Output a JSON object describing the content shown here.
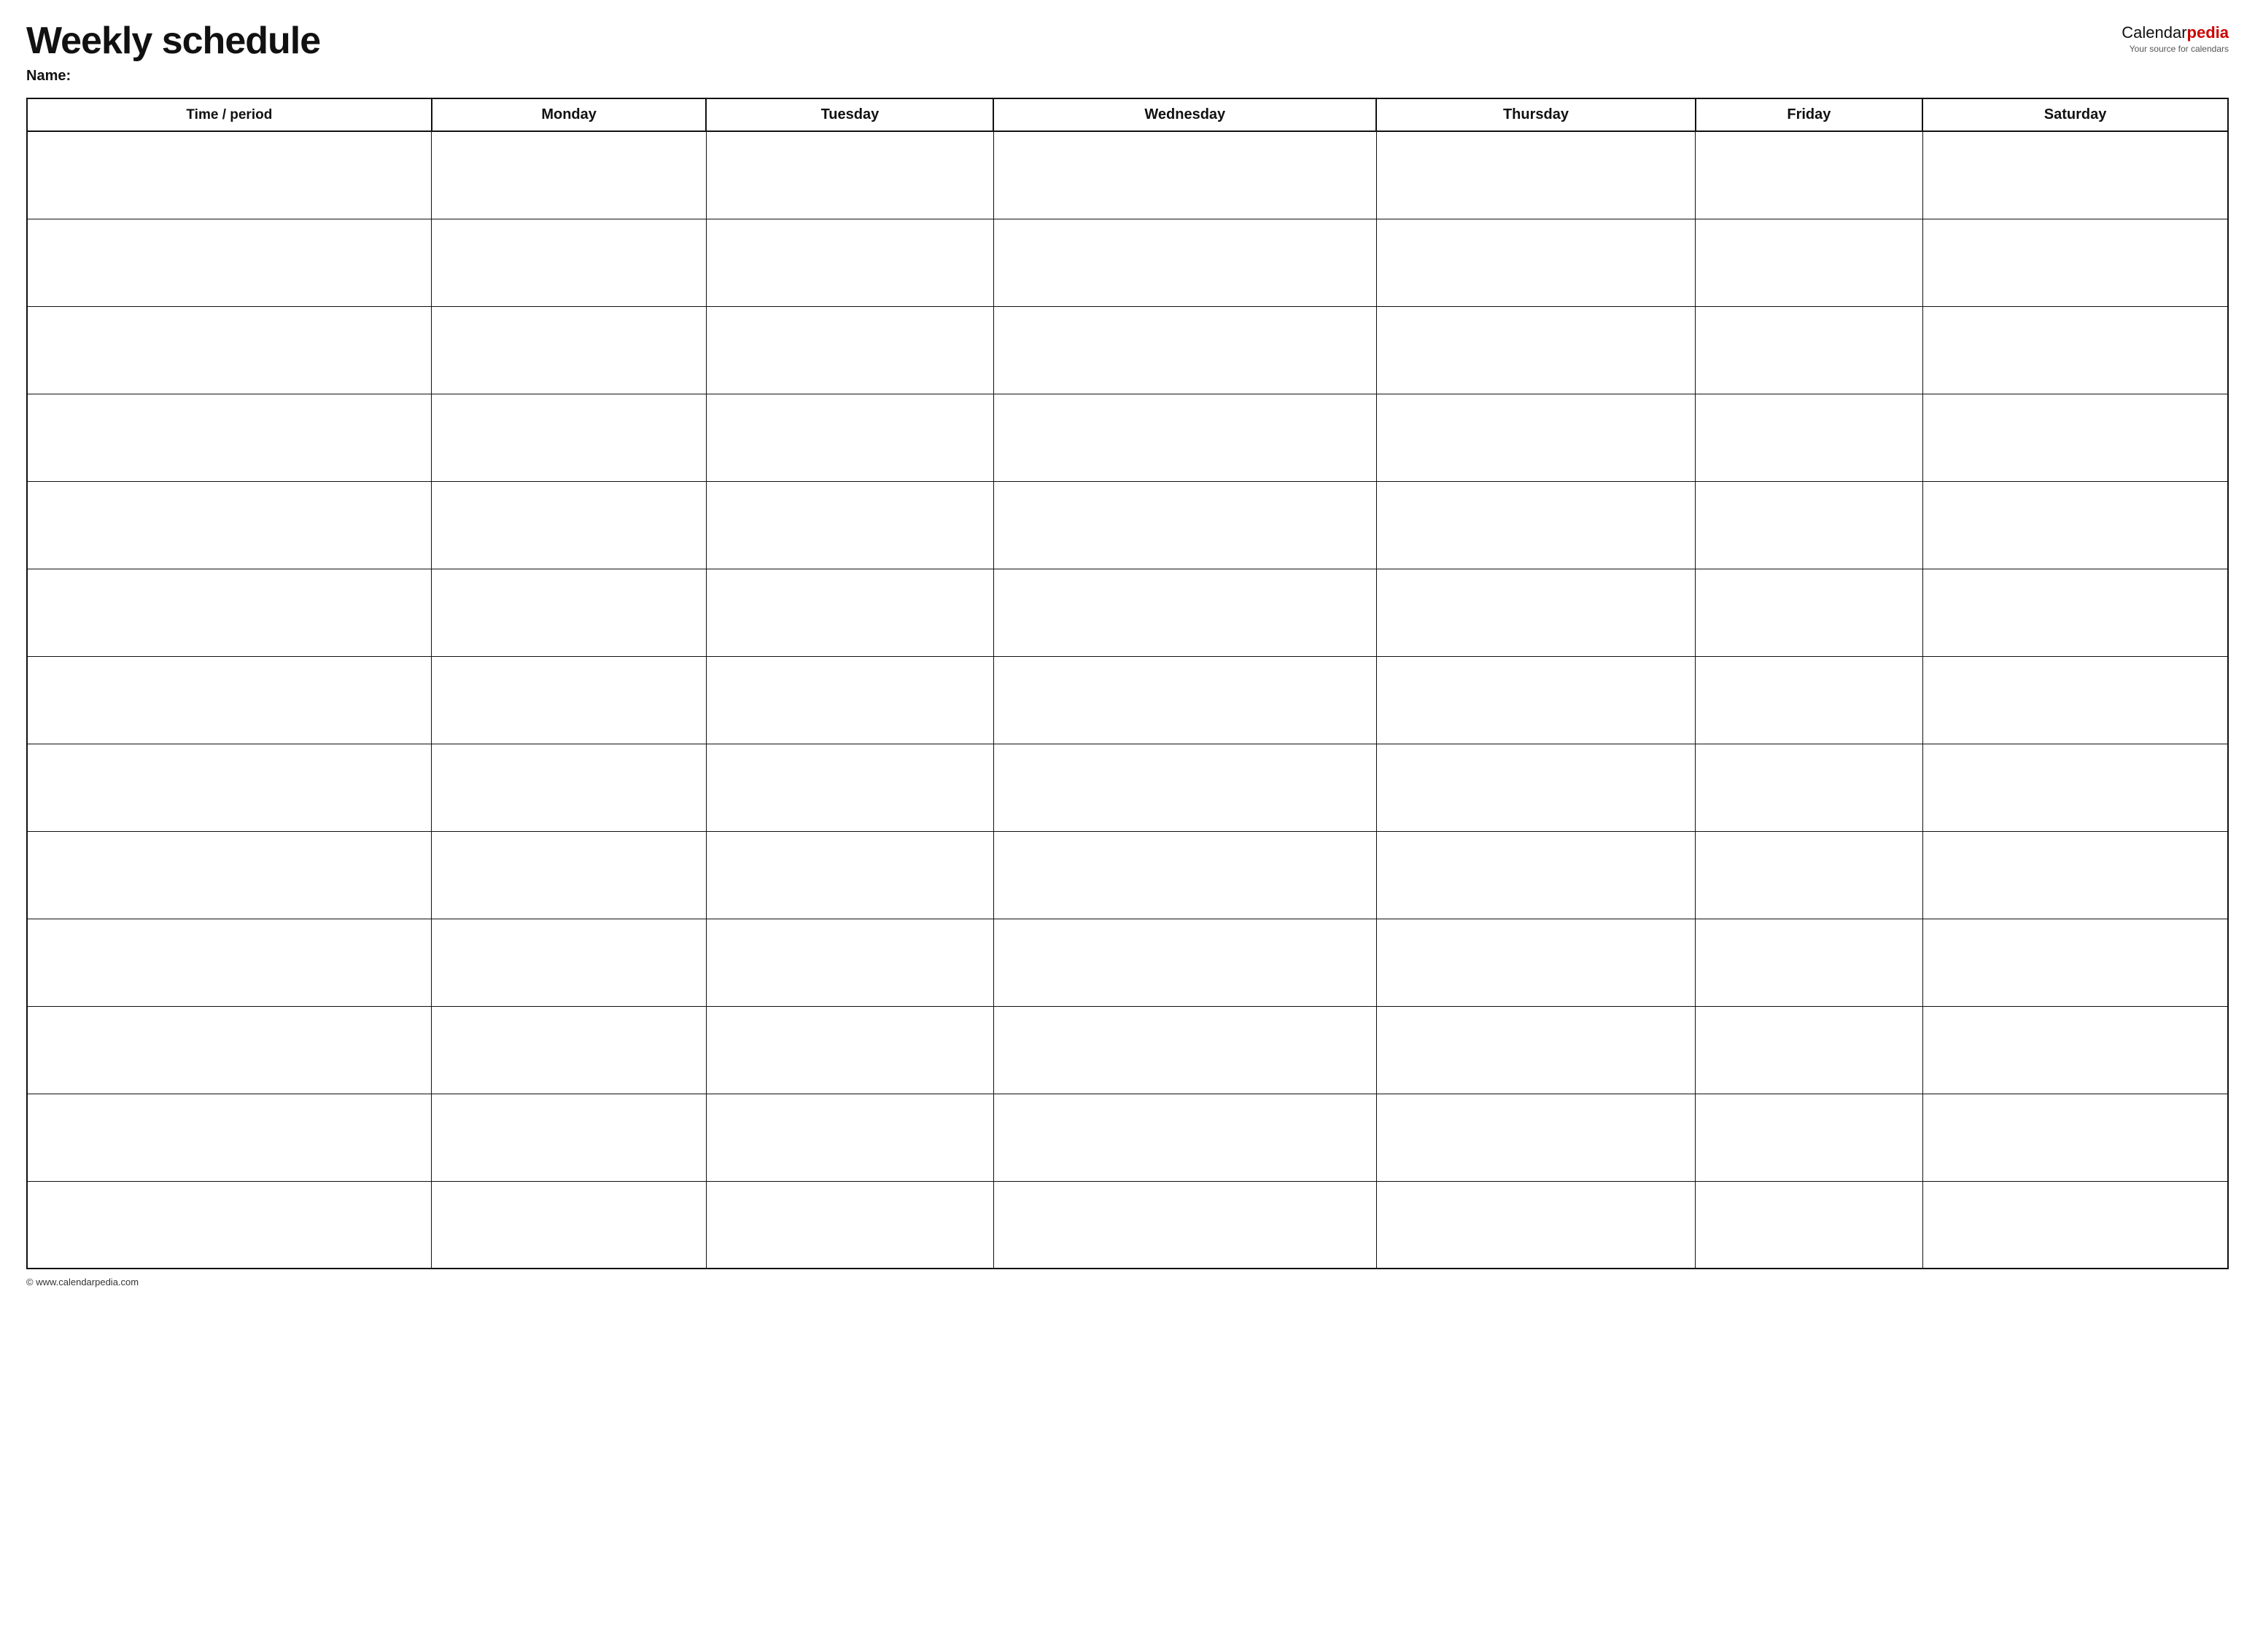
{
  "header": {
    "title": "Weekly schedule",
    "name_label": "Name:",
    "brand": {
      "name_part1": "Calendar",
      "name_part2": "pedia",
      "tagline": "Your source for calendars"
    }
  },
  "table": {
    "columns": [
      {
        "id": "time",
        "label": "Time / period"
      },
      {
        "id": "monday",
        "label": "Monday"
      },
      {
        "id": "tuesday",
        "label": "Tuesday"
      },
      {
        "id": "wednesday",
        "label": "Wednesday"
      },
      {
        "id": "thursday",
        "label": "Thursday"
      },
      {
        "id": "friday",
        "label": "Friday"
      },
      {
        "id": "saturday",
        "label": "Saturday"
      }
    ],
    "row_count": 13
  },
  "footer": {
    "copyright": "© www.calendarpedia.com"
  }
}
